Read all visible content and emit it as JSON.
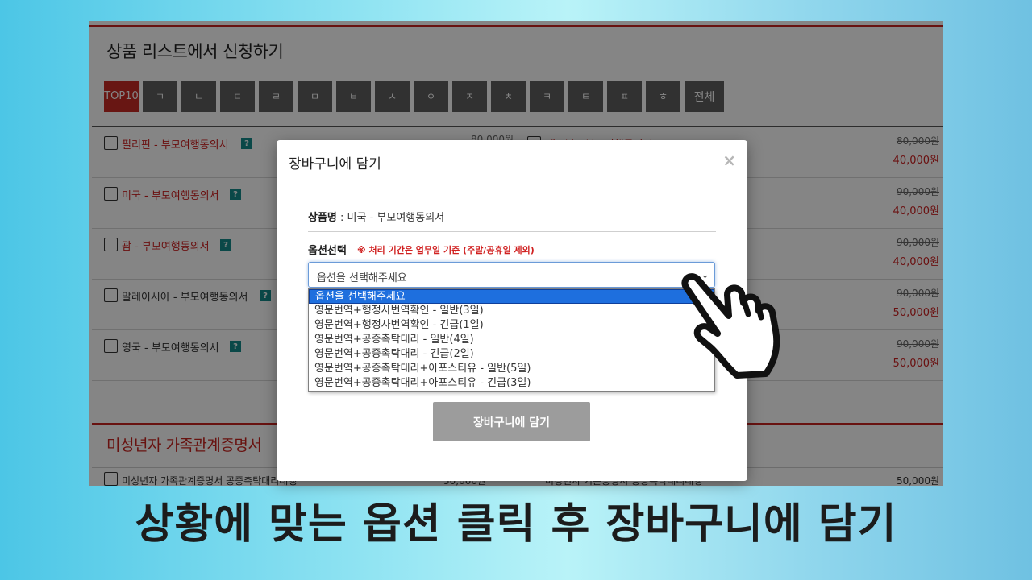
{
  "page": {
    "section_title": "상품 리스트에서 신청하기",
    "alpha_tabs": [
      "TOP10",
      "ㄱ",
      "ㄴ",
      "ㄷ",
      "ㄹ",
      "ㅁ",
      "ㅂ",
      "ㅅ",
      "ㅇ",
      "ㅈ",
      "ㅊ",
      "ㅋ",
      "ㅌ",
      "ㅍ",
      "ㅎ",
      "전체"
    ],
    "active_tab": "TOP10",
    "products": [
      {
        "name": "필리핀 - 부모여행동의서",
        "price_old": "80,000원",
        "price_new": "40,000원",
        "mid_price": "80,000원",
        "mid_name": "베트남 - 부모여행동의서"
      },
      {
        "name": "미국 - 부모여행동의서",
        "price_old": "90,000원",
        "price_new": "40,000원"
      },
      {
        "name": "괌 - 부모여행동의서",
        "price_old": "90,000원",
        "price_new": "40,000원"
      },
      {
        "name": "말레이시아 - 부모여행동의서",
        "price_old": "90,000원",
        "price_new": "50,000원"
      },
      {
        "name": "영국 - 부모여행동의서",
        "price_old": "90,000원",
        "price_new": "50,000원"
      }
    ],
    "section2_title": "미성년자 가족관계증명서",
    "row2": {
      "name1": "미성년자 가족관계증명서 공증촉탁대리대행",
      "price1": "50,000원",
      "name2": "미성년자 기본증명서 공증촉탁대리대행",
      "price2": "50,000원"
    }
  },
  "modal": {
    "title": "장바구니에 담기",
    "close": "×",
    "product_label": "상품명",
    "product_value": " : 미국 - 부모여행동의서",
    "option_label": "옵션선택",
    "option_note": "※ 처리 기간은 업무일 기준 (주말/공휴일 제외)",
    "select_value": "옵션을 선택해주세요",
    "chevron": "⌄",
    "options": [
      "옵션을 선택해주세요",
      "영문번역+행정사번역확인 - 일반(3일)",
      "영문번역+행정사번역확인 - 긴급(1일)",
      "영문번역+공증촉탁대리 - 일반(4일)",
      "영문번역+공증촉탁대리 - 긴급(2일)",
      "영문번역+공증촉탁대리+아포스티유 - 일반(5일)",
      "영문번역+공증촉탁대리+아포스티유 - 긴급(3일)"
    ],
    "button": "장바구니에 담기"
  },
  "caption": "상황에 맞는 옵션 클릭 후 장바구니에 담기",
  "colors": {
    "accent": "#c8241f",
    "select_highlight": "#1e6fde",
    "button": "#9c9c9c"
  },
  "icons": {
    "hand": "pointing-hand-icon",
    "help": "question-badge-icon"
  }
}
